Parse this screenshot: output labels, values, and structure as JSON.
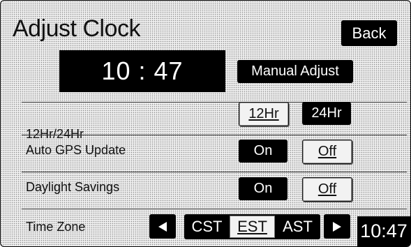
{
  "header": {
    "title": "Adjust Clock",
    "back_label": "Back"
  },
  "clock": {
    "time": "10 : 47",
    "manual_adjust_label": "Manual Adjust"
  },
  "rows": {
    "format": {
      "label": "12Hr/24Hr",
      "option_a": "12Hr",
      "option_b": "24Hr",
      "selected": "24Hr"
    },
    "gps": {
      "label": "Auto GPS Update",
      "option_a": "On",
      "option_b": "Off",
      "selected": "On"
    },
    "dst": {
      "label": "Daylight Savings",
      "option_a": "On",
      "option_b": "Off",
      "selected": "On"
    },
    "timezone": {
      "label": "Time Zone",
      "prev_icon": "arrow-left-icon",
      "next_icon": "arrow-right-icon",
      "zones": [
        "CST",
        "EST",
        "AST"
      ],
      "selected": "EST"
    }
  },
  "status": {
    "time": "10:47"
  },
  "colors": {
    "background": "#eeeeee",
    "button_dark": "#000000",
    "button_light": "#f2f2f2"
  }
}
